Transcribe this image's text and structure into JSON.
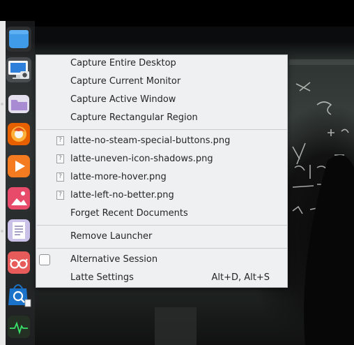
{
  "colors": {
    "menu_bg": "#eff0f1",
    "menu_text": "#232627",
    "separator": "#c9cbcd",
    "dock_bg": "#2b2d2f"
  },
  "dock": {
    "launchers": [
      {
        "name": "window-launcher",
        "icon": "window-icon",
        "color": "#3f9ae8"
      },
      {
        "name": "spectacle-launcher",
        "icon": "screenshot-icon",
        "color": "#d9dde0"
      },
      {
        "name": "files-launcher",
        "icon": "folder-icon",
        "color": "#b99ad6"
      },
      {
        "name": "firefox-launcher",
        "icon": "firefox-icon",
        "color": "#e66000"
      },
      {
        "name": "media-launcher",
        "icon": "play-icon",
        "color": "#f47b20"
      },
      {
        "name": "images-launcher",
        "icon": "image-icon",
        "color": "#e84a6a"
      },
      {
        "name": "notes-launcher",
        "icon": "document-icon",
        "color": "#c9c1e8"
      },
      {
        "name": "viewer-launcher",
        "icon": "glasses-icon",
        "color": "#e85b5b"
      },
      {
        "name": "discover-launcher",
        "icon": "discover-icon",
        "color": "#1a73c9"
      },
      {
        "name": "monitor-launcher",
        "icon": "activity-icon",
        "color": "#243024"
      }
    ]
  },
  "menu": {
    "actions": [
      "Capture Entire Desktop",
      "Capture Current Monitor",
      "Capture Active Window",
      "Capture Rectangular Region"
    ],
    "recent_files": [
      "latte-no-steam-special-buttons.png",
      "latte-uneven-icon-shadows.png",
      "latte-more-hover.png",
      "latte-left-no-better.png"
    ],
    "forget_recent": "Forget Recent Documents",
    "remove_launcher": "Remove Launcher",
    "alternative_session": "Alternative Session",
    "latte_settings": "Latte Settings",
    "latte_settings_shortcut": "Alt+D, Alt+S",
    "file_icon_glyph": "?"
  }
}
